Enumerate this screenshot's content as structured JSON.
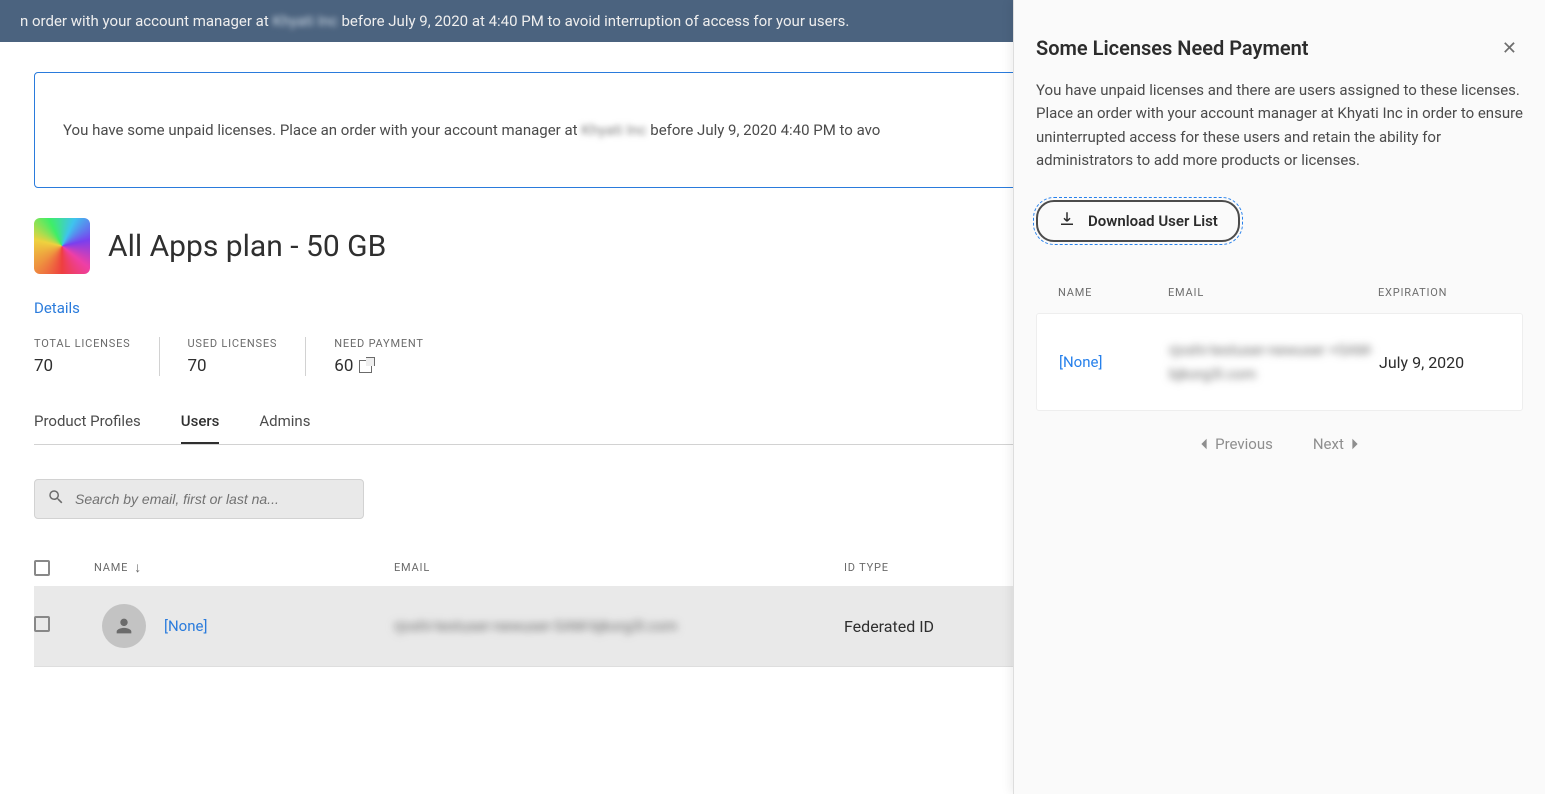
{
  "top_banner": {
    "prefix": "n order with your account manager at ",
    "company": "Khyati Inc",
    "suffix": " before July 9, 2020 at 4:40 PM to avoid interruption of access for your users."
  },
  "warning": {
    "prefix": "You have some unpaid licenses. Place an order with your account manager at ",
    "company": "Khyati Inc",
    "suffix": " before July 9, 2020 4:40 PM to avo"
  },
  "plan": {
    "title": "All Apps plan - 50 GB",
    "details_link": "Details"
  },
  "stats": {
    "total": {
      "label": "TOTAL LICENSES",
      "value": "70"
    },
    "used": {
      "label": "USED LICENSES",
      "value": "70"
    },
    "need": {
      "label": "NEED PAYMENT",
      "value": "60"
    }
  },
  "tabs": {
    "profiles": "Product Profiles",
    "users": "Users",
    "admins": "Admins"
  },
  "search": {
    "placeholder": "Search by email, first or last na..."
  },
  "user_table": {
    "headers": {
      "name": "NAME",
      "email": "EMAIL",
      "idtype": "ID TYPE"
    },
    "rows": [
      {
        "name": "[None]",
        "email": "rjoshi-testuser-newuser-SAM-bjkorg3l.com",
        "idtype": "Federated ID"
      }
    ]
  },
  "modal": {
    "title": "Some Licenses Need Payment",
    "body": "You have unpaid licenses and there are users assigned to these licenses. Place an order with your account manager at Khyati Inc in order to ensure uninterrupted access for these users and retain the ability for administrators to add more products or licenses.",
    "download": "Download User List",
    "headers": {
      "name": "NAME",
      "email": "EMAIL",
      "expiration": "EXPIRATION"
    },
    "row": {
      "name": "[None]",
      "email": "rjoshi-testuser-newuser +SAM-bjkorg3l.com",
      "expiration": "July 9, 2020"
    },
    "prev": "Previous",
    "next": "Next"
  }
}
